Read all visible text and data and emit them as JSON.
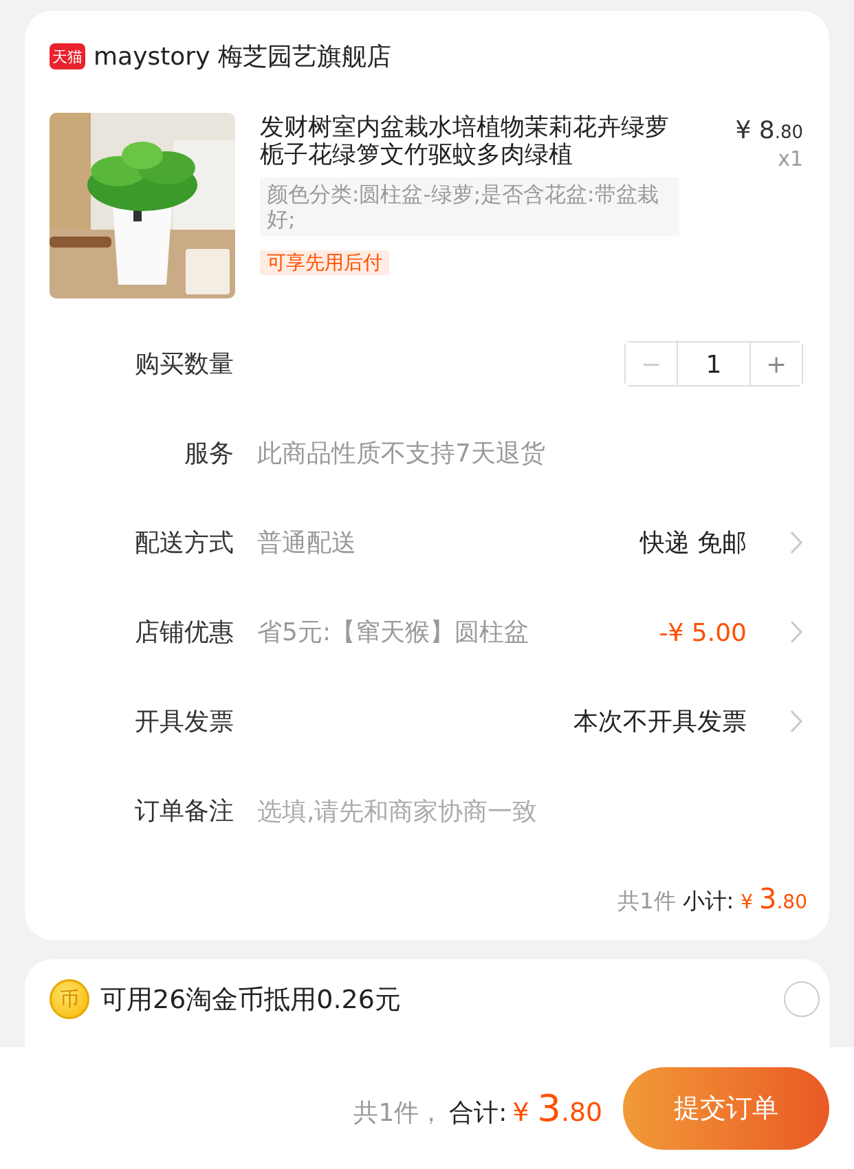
{
  "store": {
    "badge": "天猫",
    "name": "maystory 梅芝园艺旗舰店"
  },
  "product": {
    "title": "发财树室内盆栽水培植物茉莉花卉绿萝栀子花绿箩文竹驱蚊多肉绿植",
    "price": {
      "currency": "¥",
      "integer": "8",
      "decimal": ".80"
    },
    "quantity": "x1",
    "spec": "颜色分类:圆柱盆-绿萝;是否含花盆:带盆栽好;",
    "tag": "可享先用后付"
  },
  "rows": [
    {
      "kind": "stepper",
      "label": "购买数量",
      "value": "1",
      "decrement": {
        "symbol": "−",
        "disabled": true
      },
      "increment": {
        "symbol": "+",
        "disabled": false
      }
    },
    {
      "kind": "info",
      "label": "服务",
      "value": "此商品性质不支持7天退货"
    },
    {
      "kind": "option",
      "label": "配送方式",
      "value": "普通配送",
      "detail": "快递 免邮",
      "highlight": false
    },
    {
      "kind": "option",
      "label": "店铺优惠",
      "value": "省5元:【窜天猴】圆柱盆",
      "detail": "-¥ 5.00",
      "highlight": true
    },
    {
      "kind": "option",
      "label": "开具发票",
      "detail": "本次不开具发票",
      "highlight": false
    },
    {
      "kind": "input",
      "label": "订单备注",
      "placeholder": "选填,请先和商家协商一致"
    }
  ],
  "subtotal": {
    "count": "共1件",
    "label": "小计:",
    "currency": "¥",
    "integer": "3",
    "decimal": ".80"
  },
  "coins": {
    "glyph": "币",
    "text": "可用26淘金币抵用0.26元",
    "selected": false
  },
  "footer": {
    "count": "共1件，",
    "label": "合计:",
    "currency": "¥",
    "integer": "3",
    "decimal": ".80",
    "submit": "提交订单"
  }
}
